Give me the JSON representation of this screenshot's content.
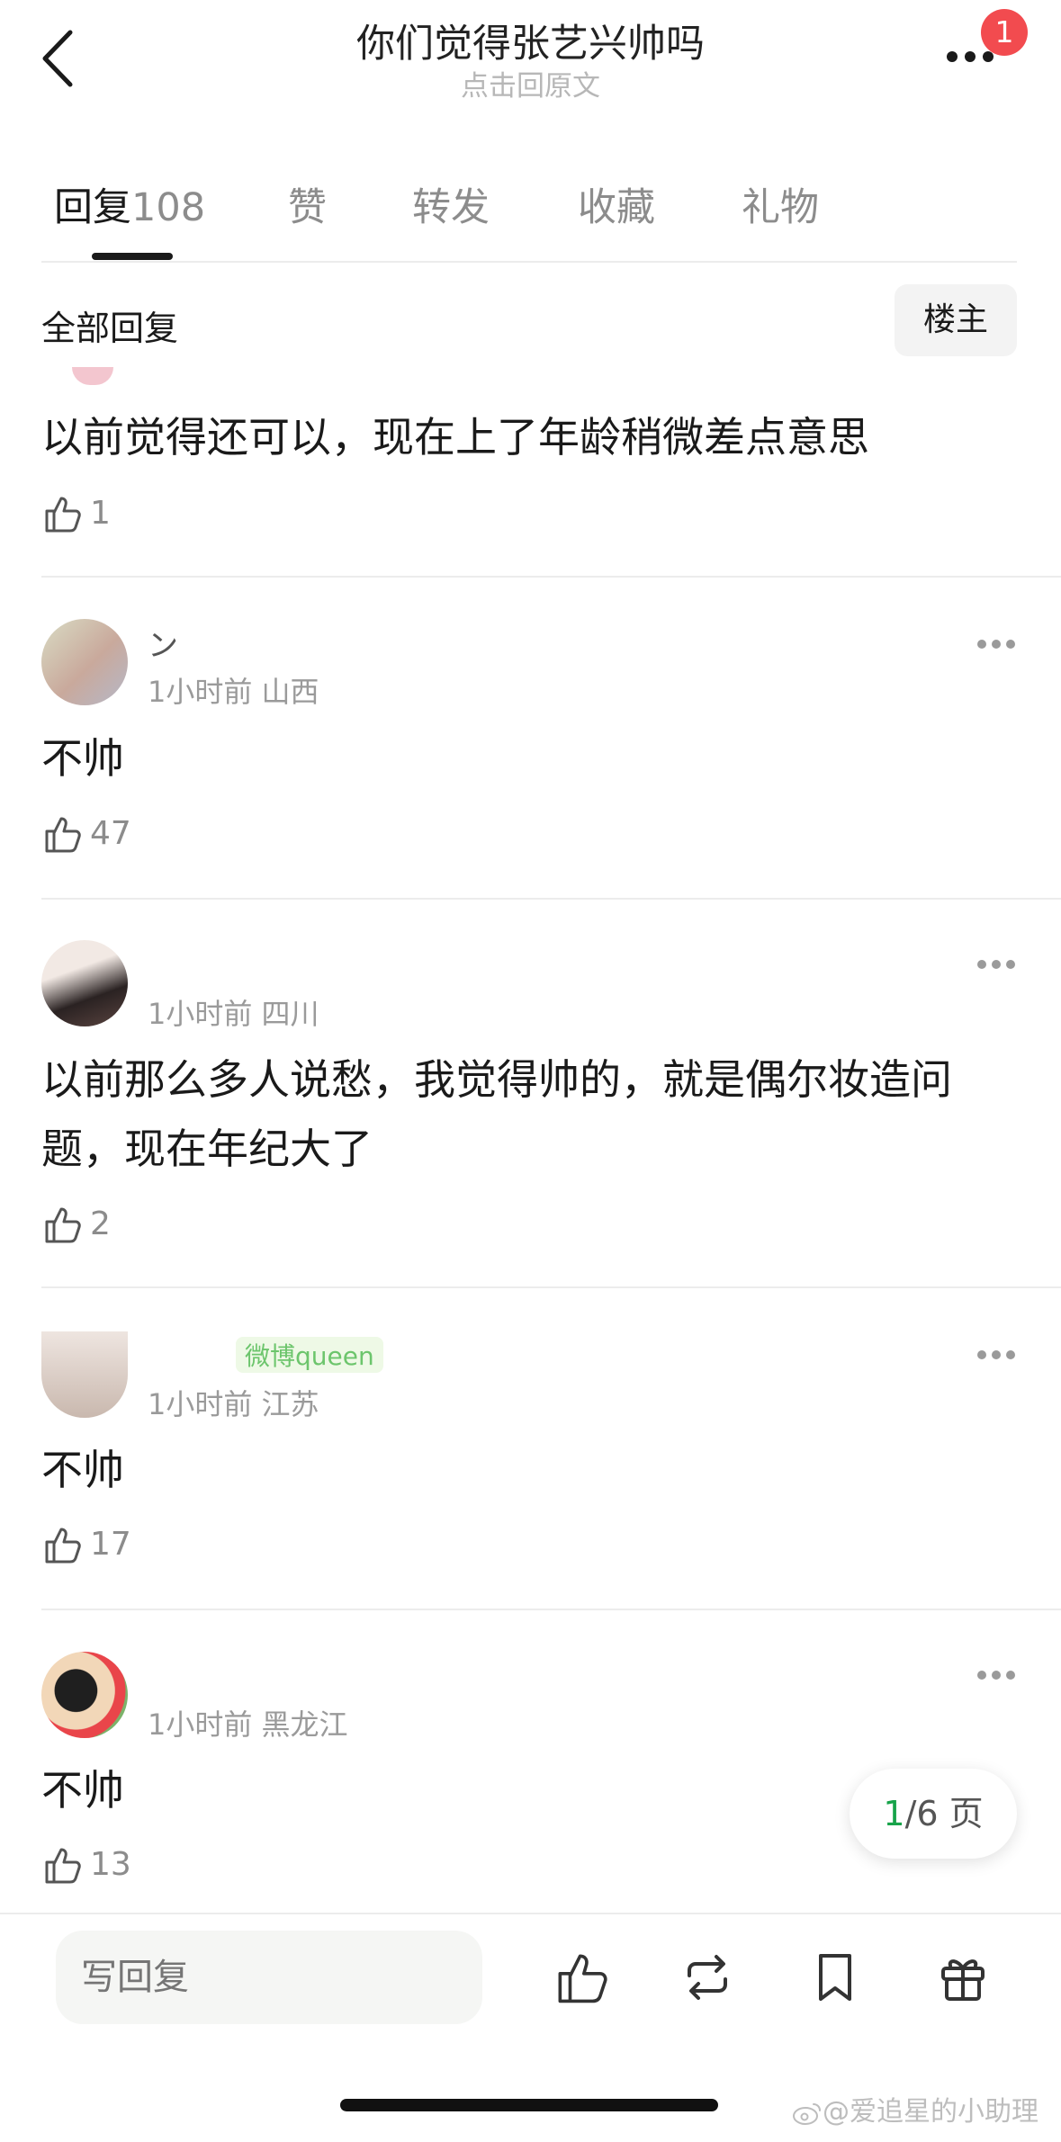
{
  "header": {
    "title": "你们觉得张艺兴帅吗",
    "subtitle": "点击回原文",
    "badge_count": "1"
  },
  "tabs": [
    {
      "label": "回复",
      "count": "108",
      "active": true
    },
    {
      "label": "赞"
    },
    {
      "label": "转发"
    },
    {
      "label": "收藏"
    },
    {
      "label": "礼物"
    }
  ],
  "section": {
    "title": "全部回复",
    "owner_button": "楼主"
  },
  "posts": [
    {
      "text": "以前觉得还可以，现在上了年龄稍微差点意思",
      "likes": "1"
    },
    {
      "username": "ン",
      "meta": "1小时前 山西",
      "text": "不帅",
      "likes": "47"
    },
    {
      "meta": "1小时前 四川",
      "text_line1": "以前那么多人说愁，我觉得帅的，就是偶尔妆造问",
      "text_line2": "题，现在年纪大了",
      "likes": "2"
    },
    {
      "tag": "微博queen",
      "meta": "1小时前 江苏",
      "text": "不帅",
      "likes": "17"
    },
    {
      "meta": "1小时前 黑龙江",
      "text": "不帅",
      "likes": "13"
    }
  ],
  "pager": {
    "current": "1",
    "rest": "/6 页"
  },
  "bottom": {
    "placeholder": "写回复"
  },
  "watermark": "@爱追星的小助理",
  "icons": [
    "back-arrow-icon",
    "more-icon",
    "thumbs-up-icon",
    "repost-icon",
    "bookmark-icon",
    "gift-icon",
    "weibo-icon"
  ],
  "colors": {
    "badge": "#f24b4f",
    "pager_current": "#17a34a",
    "meta_text": "#9a9a9a"
  }
}
